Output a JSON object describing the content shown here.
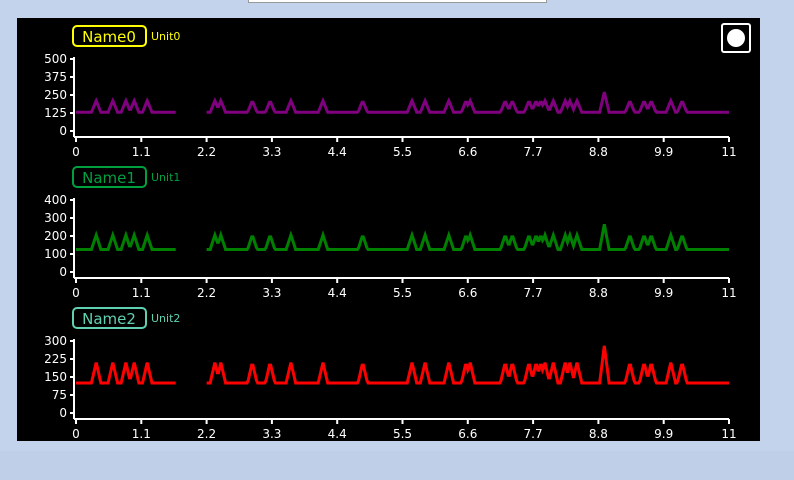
{
  "chart_data": [
    {
      "type": "line",
      "name": "Name0",
      "unit": "Unit0",
      "color": "#800080",
      "label_color": "#ffff00",
      "ylim": [
        0,
        500
      ],
      "yticks": [
        0,
        125,
        250,
        375,
        500
      ],
      "xlim": [
        0,
        11
      ],
      "xticks": [
        "0",
        "1.1",
        "2.2",
        "3.3",
        "4.4",
        "5.5",
        "6.6",
        "7.7",
        "8.8",
        "9.9",
        "11"
      ],
      "baseline": 130,
      "spike_height": 210,
      "gap": [
        1.7,
        2.2
      ],
      "spikes_x": [
        0.34,
        0.62,
        0.84,
        0.98,
        1.2,
        2.34,
        2.44,
        2.97,
        3.27,
        3.62,
        4.16,
        4.83,
        5.66,
        5.88,
        6.28,
        6.57,
        6.64,
        7.23,
        7.35,
        7.63,
        7.75,
        7.83,
        7.9,
        8.04,
        8.24,
        8.32,
        8.44,
        8.9,
        9.33,
        9.57,
        9.69,
        10.02,
        10.21
      ],
      "tall_spike": {
        "x": 8.9,
        "y": 270
      }
    },
    {
      "type": "line",
      "name": "Name1",
      "unit": "Unit1",
      "color": "#008000",
      "label_color": "#00a040",
      "ylim": [
        0,
        400
      ],
      "yticks": [
        0,
        100,
        200,
        300,
        400
      ],
      "xlim": [
        0,
        11
      ],
      "xticks": [
        "0",
        "1.1",
        "2.2",
        "3.3",
        "4.4",
        "5.5",
        "6.6",
        "7.7",
        "8.8",
        "9.9",
        "11"
      ],
      "baseline": 125,
      "spike_height": 205,
      "gap": [
        1.7,
        2.2
      ],
      "spikes_x": [
        0.34,
        0.62,
        0.84,
        0.98,
        1.2,
        2.34,
        2.44,
        2.97,
        3.27,
        3.62,
        4.16,
        4.83,
        5.66,
        5.88,
        6.28,
        6.57,
        6.64,
        7.23,
        7.35,
        7.63,
        7.75,
        7.83,
        7.9,
        8.04,
        8.24,
        8.32,
        8.44,
        8.9,
        9.33,
        9.57,
        9.69,
        10.02,
        10.21
      ],
      "tall_spike": {
        "x": 8.9,
        "y": 265
      }
    },
    {
      "type": "line",
      "name": "Name2",
      "unit": "Unit2",
      "color": "#ff0000",
      "label_color": "#60d0b0",
      "ylim": [
        0,
        300
      ],
      "yticks": [
        0,
        75,
        150,
        225,
        300
      ],
      "xlim": [
        0,
        11
      ],
      "xticks": [
        "0",
        "1.1",
        "2.2",
        "3.3",
        "4.4",
        "5.5",
        "6.6",
        "7.7",
        "8.8",
        "9.9",
        "11"
      ],
      "baseline": 125,
      "spike_height": 210,
      "gap": [
        1.7,
        2.2
      ],
      "spikes_x": [
        0.34,
        0.62,
        0.84,
        0.98,
        1.2,
        2.34,
        2.44,
        2.97,
        3.27,
        3.62,
        4.16,
        4.83,
        5.66,
        5.88,
        6.28,
        6.57,
        6.64,
        7.23,
        7.35,
        7.63,
        7.75,
        7.83,
        7.9,
        8.04,
        8.24,
        8.32,
        8.44,
        8.9,
        9.33,
        9.57,
        9.69,
        10.02,
        10.21
      ],
      "tall_spike": {
        "x": 8.9,
        "y": 280
      }
    }
  ]
}
